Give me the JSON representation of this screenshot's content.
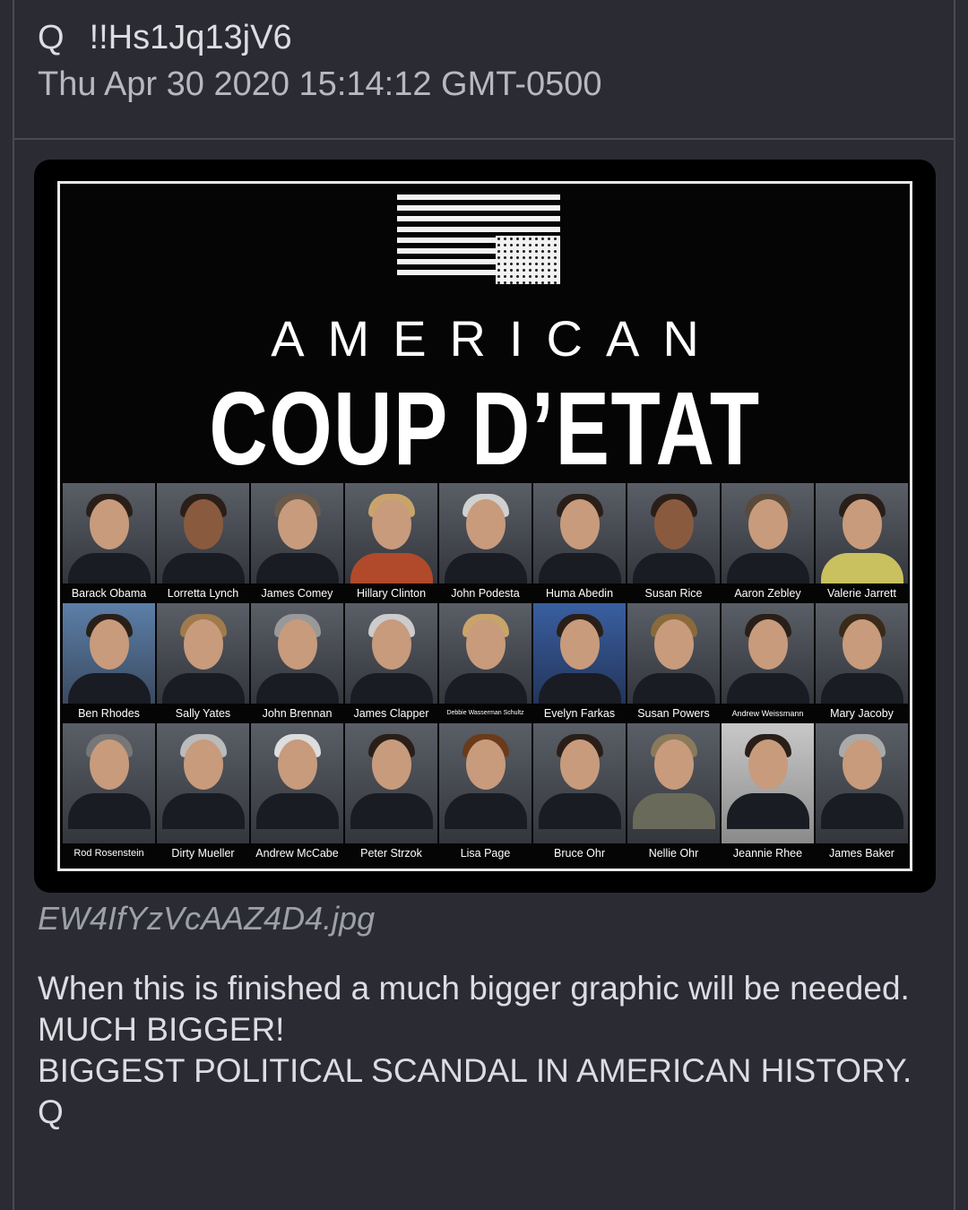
{
  "post": {
    "author_marker": "Q",
    "tripcode": "!!Hs1Jq13jV6",
    "timestamp": "Thu Apr 30 2020 15:14:12 GMT-0500"
  },
  "image": {
    "headline_small": "AMERICAN",
    "headline_big": "COUP D’ETAT",
    "rows": [
      [
        "Barack Obama",
        "Lorretta Lynch",
        "James Comey",
        "Hillary Clinton",
        "John Podesta",
        "Huma Abedin",
        "Susan Rice",
        "Aaron Zebley",
        "Valerie Jarrett"
      ],
      [
        "Ben Rhodes",
        "Sally Yates",
        "John Brennan",
        "James Clapper",
        "Debbie Wasserman Schultz",
        "Evelyn Farkas",
        "Susan Powers",
        "Andrew Weissmann",
        "Mary Jacoby"
      ],
      [
        "Rod Rosenstein",
        "Dirty Mueller",
        "Andrew McCabe",
        "Peter Strzok",
        "Lisa Page",
        "Bruce Ohr",
        "Nellie Ohr",
        "Jeannie Rhee",
        "James Baker"
      ]
    ]
  },
  "attachment": {
    "filename": "EW4IfYzVcAAZ4D4.jpg"
  },
  "body": {
    "lines": [
      "When this is finished a much bigger graphic will be needed.",
      "MUCH BIGGER!",
      "BIGGEST POLITICAL SCANDAL IN AMERICAN HISTORY.",
      "Q"
    ]
  }
}
